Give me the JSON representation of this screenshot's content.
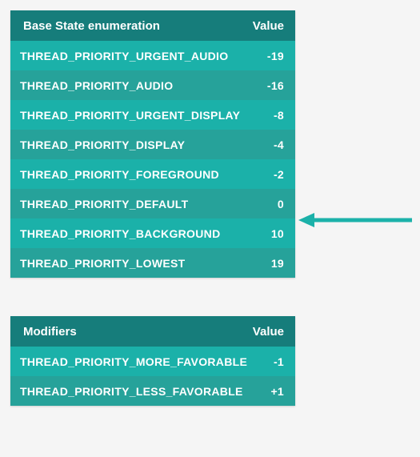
{
  "tables": [
    {
      "header_label": "Base State enumeration",
      "header_value": "Value",
      "rows": [
        {
          "name": "THREAD_PRIORITY_URGENT_AUDIO",
          "value": "-19"
        },
        {
          "name": "THREAD_PRIORITY_AUDIO",
          "value": "-16"
        },
        {
          "name": "THREAD_PRIORITY_URGENT_DISPLAY",
          "value": "-8"
        },
        {
          "name": "THREAD_PRIORITY_DISPLAY",
          "value": "-4"
        },
        {
          "name": "THREAD_PRIORITY_FOREGROUND",
          "value": "-2"
        },
        {
          "name": "THREAD_PRIORITY_DEFAULT",
          "value": "0"
        },
        {
          "name": "THREAD_PRIORITY_BACKGROUND",
          "value": "10"
        },
        {
          "name": "THREAD_PRIORITY_LOWEST",
          "value": "19"
        }
      ]
    },
    {
      "header_label": "Modifiers",
      "header_value": "Value",
      "rows": [
        {
          "name": "THREAD_PRIORITY_MORE_FAVORABLE",
          "value": "-1"
        },
        {
          "name": "THREAD_PRIORITY_LESS_FAVORABLE",
          "value": "+1"
        }
      ]
    }
  ],
  "arrow_color": "#1bb1a9",
  "highlight_row_index": 5
}
